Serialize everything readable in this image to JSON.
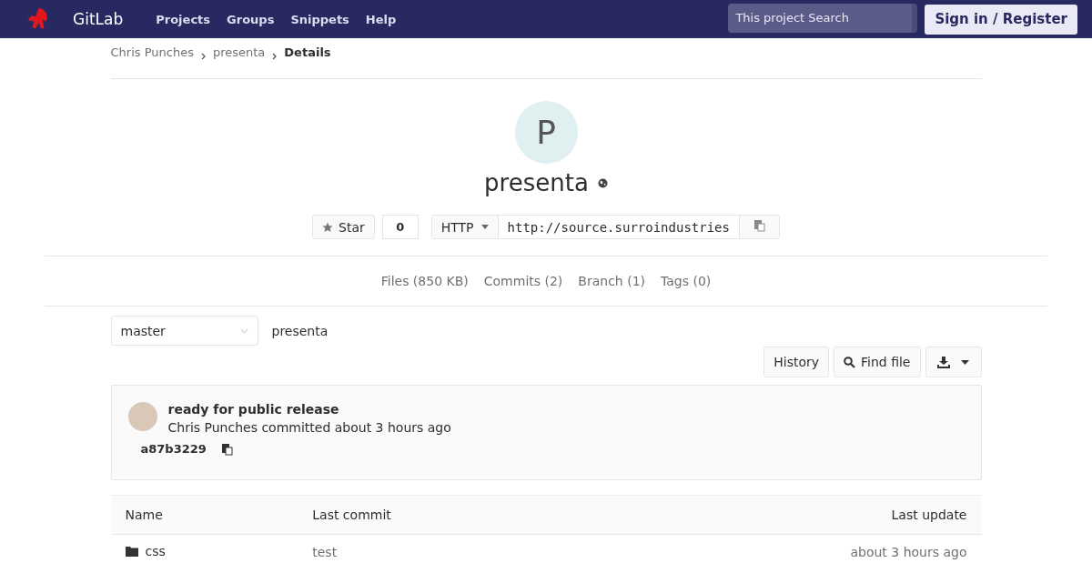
{
  "navbar": {
    "brand": "GitLab",
    "links": [
      "Projects",
      "Groups",
      "Snippets",
      "Help"
    ],
    "search": {
      "placeholder": "This project Search"
    },
    "sign_in": "Sign in / Register"
  },
  "breadcrumbs": [
    {
      "label": "Chris Punches",
      "current": false
    },
    {
      "label": "presenta",
      "current": false
    },
    {
      "label": "Details",
      "current": true
    }
  ],
  "project": {
    "avatar_letter": "P",
    "name": "presenta",
    "star_label": "Star",
    "star_count": "0",
    "protocol": "HTTP",
    "clone_url": "http://source.surroindustries"
  },
  "stats": [
    "Files (850 KB)",
    "Commits (2)",
    "Branch (1)",
    "Tags (0)"
  ],
  "branch": "master",
  "path": "presenta",
  "actions": {
    "history": "History",
    "find_file": "Find file"
  },
  "commit": {
    "title": "ready for public release",
    "author": "Chris Punches",
    "meta": "committed about 3 hours ago",
    "sha": "a87b3229"
  },
  "table": {
    "columns": [
      "Name",
      "Last commit",
      "Last update"
    ],
    "rows": [
      {
        "kind": "folder",
        "name": "css",
        "last_commit": "test",
        "last_update": "about 3 hours ago"
      }
    ]
  }
}
